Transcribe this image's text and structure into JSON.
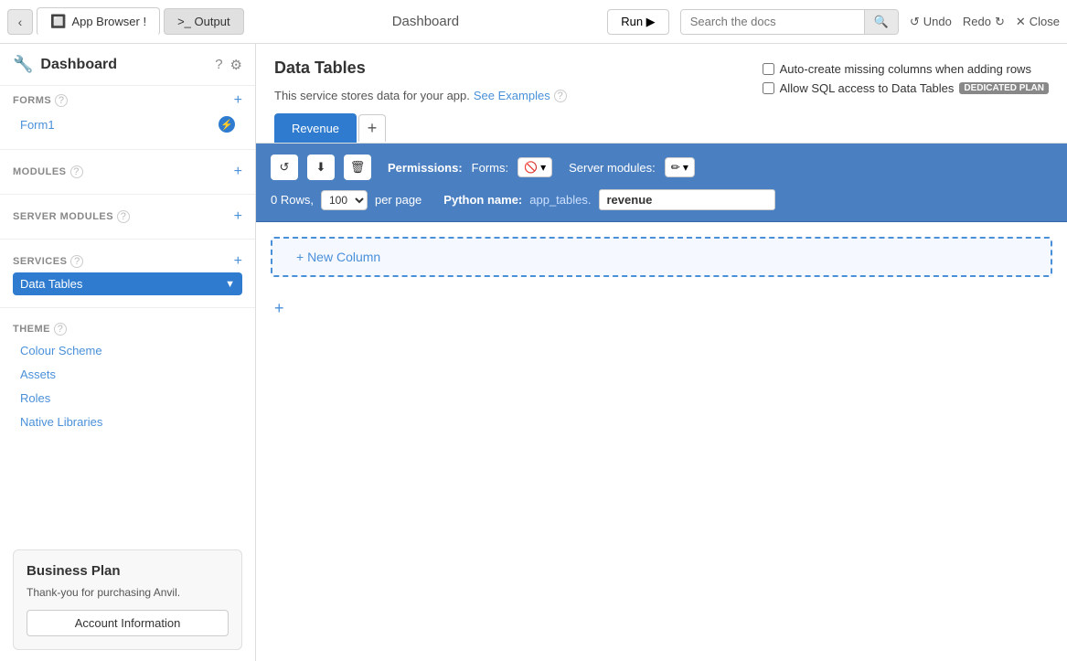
{
  "topbar": {
    "back_label": "‹",
    "app_browser_tab": "App Browser !",
    "app_browser_icon": "🔲",
    "output_tab": ">_ Output",
    "title": "Dashboard",
    "run_label": "Run ▶",
    "search_placeholder": "Search the docs",
    "search_icon": "🔍",
    "undo_label": "Undo",
    "undo_icon": "↺",
    "redo_label": "Redo",
    "redo_icon": "↻",
    "close_label": "Close",
    "close_icon": "✕"
  },
  "sidebar": {
    "title": "Dashboard",
    "logo": "🔧",
    "help_icon": "?",
    "settings_icon": "⚙",
    "sections": {
      "forms": {
        "label": "FORMS",
        "help": "?",
        "add": "+"
      },
      "modules": {
        "label": "MODULES",
        "help": "?",
        "add": "+"
      },
      "server_modules": {
        "label": "SERVER MODULES",
        "help": "?",
        "add": "+"
      },
      "services": {
        "label": "SERVICES",
        "help": "?",
        "add": "+"
      },
      "theme": {
        "label": "THEME",
        "help": "?"
      }
    },
    "form1_label": "Form1",
    "form1_icon": "⚡",
    "data_tables_label": "Data Tables",
    "data_tables_icon": "▼",
    "colour_scheme_label": "Colour Scheme",
    "assets_label": "Assets",
    "roles_label": "Roles",
    "native_libraries_label": "Native Libraries"
  },
  "business_plan": {
    "title": "Business Plan",
    "description": "Thank-you for purchasing Anvil.",
    "button_label": "Account Information"
  },
  "main": {
    "title": "Data Tables",
    "description": "This service stores data for your app.",
    "see_examples_link": "See Examples",
    "help_icon": "?",
    "auto_create_label": "Auto-create missing columns when adding rows",
    "allow_sql_label": "Allow SQL access to Data Tables",
    "dedicated_plan_badge": "DEDICATED PLAN",
    "revenue_tab": "Revenue",
    "add_tab_icon": "+",
    "permissions_label": "Permissions:",
    "forms_label": "Forms:",
    "forms_value": "🚫",
    "server_modules_label": "Server modules:",
    "server_modules_value": "✏",
    "rows_label": "0 Rows,",
    "per_page_label": "per page",
    "rows_per_page": "100",
    "python_name_label": "Python name:",
    "python_prefix": "app_tables.",
    "python_value": "revenue",
    "new_column_label": "+ New Column",
    "add_row_icon": "+"
  }
}
